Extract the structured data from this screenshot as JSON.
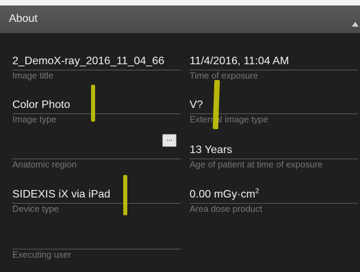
{
  "header": {
    "title": "About"
  },
  "fields": {
    "image_title": {
      "value": "2_DemoX-ray_2016_11_04_66",
      "label": "Image title"
    },
    "time_of_exposure": {
      "value": "11/4/2016, 11:04 AM",
      "label": "Time of exposure"
    },
    "image_type": {
      "value": "Color Photo",
      "label": "Image type"
    },
    "external_image_type": {
      "value": "V?",
      "label": "External image type"
    },
    "anatomic_region": {
      "value": "",
      "label": "Anatomic region",
      "button": "..."
    },
    "age_of_patient": {
      "value": "13 Years",
      "label": "Age of patient at time of exposure"
    },
    "device_type": {
      "value": "SIDEXIS iX via iPad",
      "label": "Device type"
    },
    "area_dose_product": {
      "value": "0.00 mGy·cm",
      "unit_sup": "2",
      "label": "Area dose product"
    },
    "executing_user": {
      "value": "",
      "label": "Executing user"
    }
  },
  "icons": {
    "collapse": "chevron-up-icon",
    "anatomic_button": "ellipsis-icon"
  },
  "colors": {
    "background": "#1f1f1f",
    "header": "#4e4e4e",
    "text": "#f2f2f2",
    "label": "#777777",
    "annotation": "#c8c80a"
  }
}
